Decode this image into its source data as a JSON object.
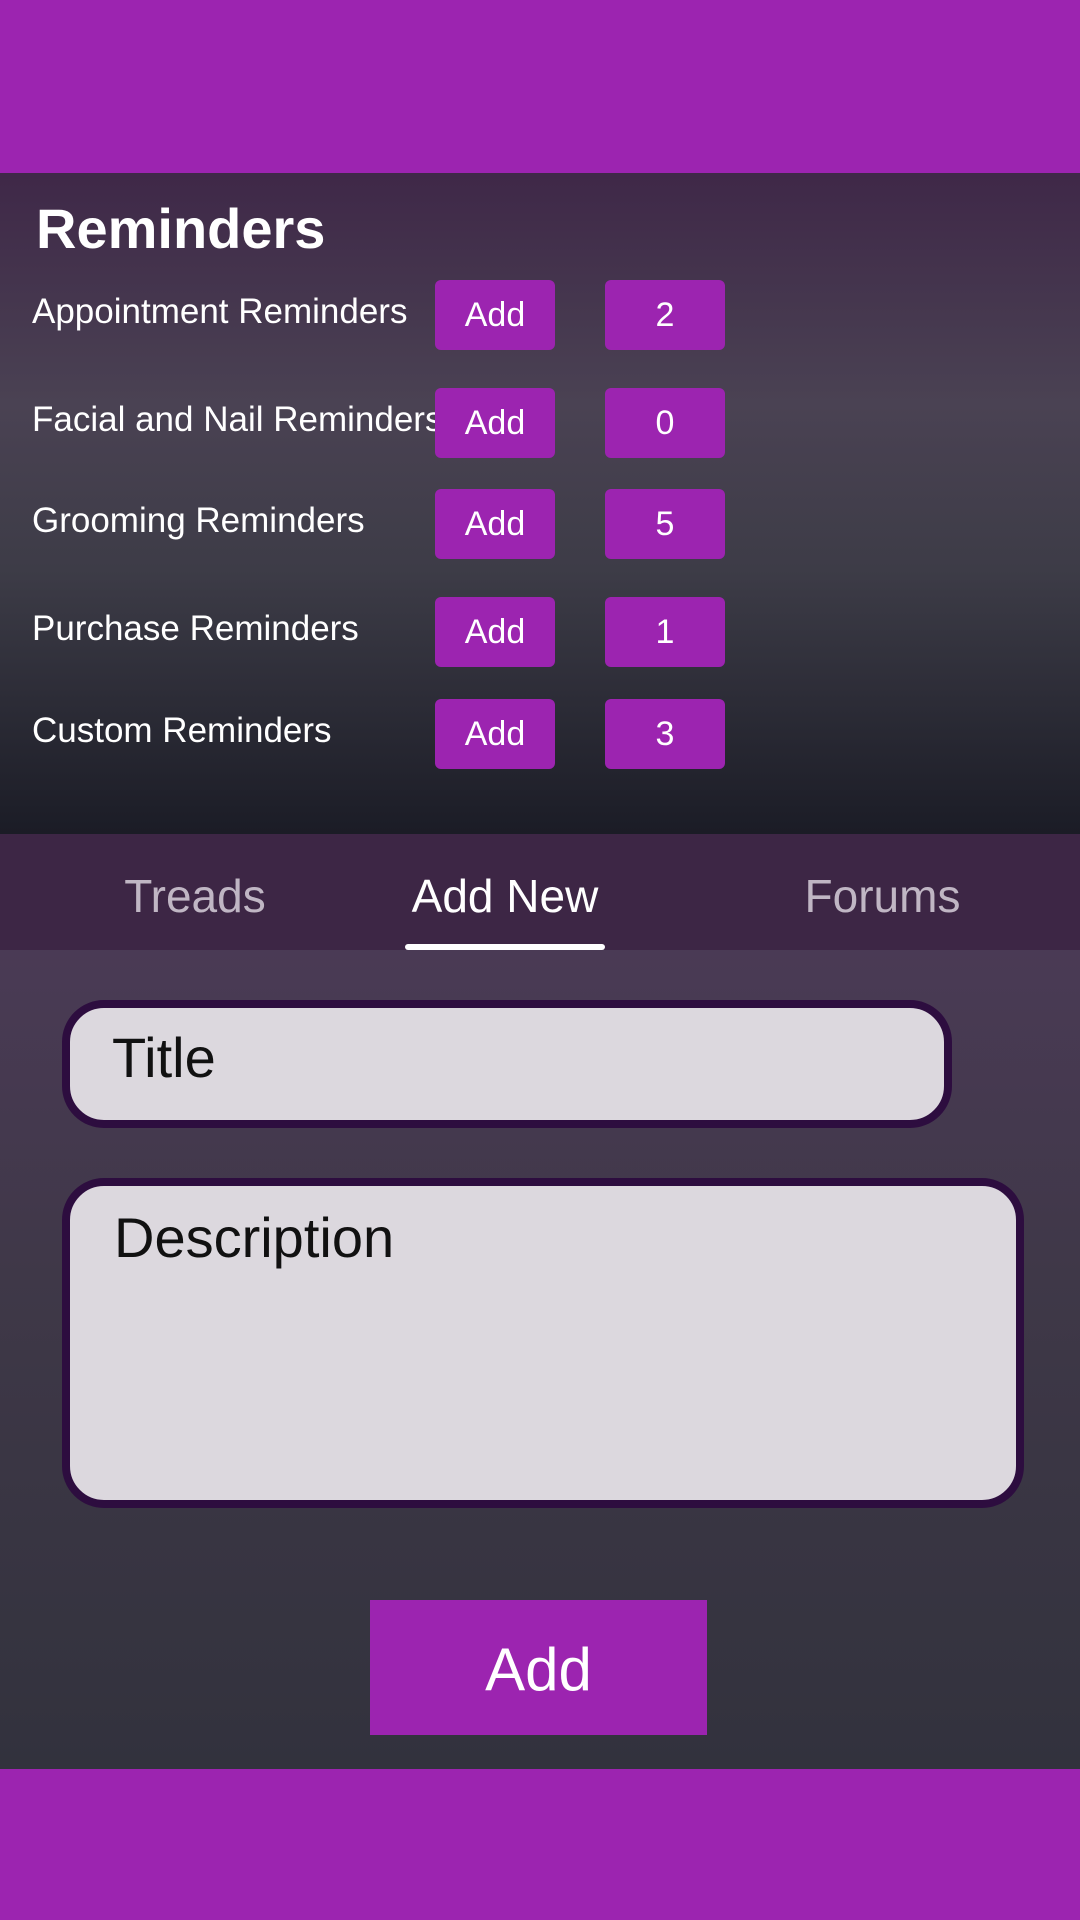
{
  "reminders": {
    "title": "Reminders",
    "add_label": "Add",
    "items": [
      {
        "label": "Appointment Reminders",
        "count": "2"
      },
      {
        "label": "Facial and Nail Reminders",
        "count": "0"
      },
      {
        "label": "Grooming Reminders",
        "count": "5"
      },
      {
        "label": "Purchase Reminders",
        "count": "1"
      },
      {
        "label": "Custom Reminders",
        "count": "3"
      }
    ]
  },
  "tabs": [
    {
      "label": "Treads",
      "active": false
    },
    {
      "label": "Add New",
      "active": true
    },
    {
      "label": "Forums",
      "active": false
    }
  ],
  "form": {
    "title_placeholder": "Title",
    "description_placeholder": "Description",
    "submit_label": "Add"
  },
  "colors": {
    "accent": "#9c24b0",
    "field_border": "#2d0d3f",
    "field_fill": "#dcd8de"
  }
}
